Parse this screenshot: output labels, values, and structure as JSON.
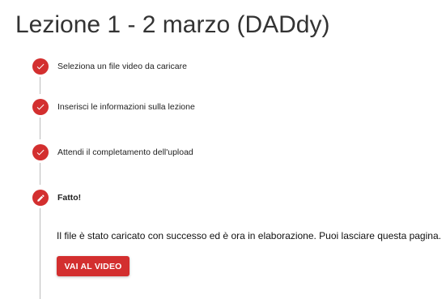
{
  "page": {
    "title": "Lezione 1 - 2 marzo (DADdy)"
  },
  "stepper": {
    "steps": [
      {
        "label": "Seleziona un file video da caricare",
        "status": "completed",
        "icon": "check-icon"
      },
      {
        "label": "Inserisci le informazioni sulla lezione",
        "status": "completed",
        "icon": "check-icon"
      },
      {
        "label": "Attendi il completamento dell'upload",
        "status": "completed",
        "icon": "check-icon"
      },
      {
        "label": "Fatto!",
        "status": "active",
        "icon": "pencil-icon"
      }
    ]
  },
  "done": {
    "message": "Il file è stato caricato con successo ed è ora in elaborazione. Puoi lasciare questa pagina.",
    "button_label": "VAI AL VIDEO"
  },
  "colors": {
    "accent": "#d32f2f",
    "connector": "#bdbdbd",
    "title_text": "#333333"
  }
}
